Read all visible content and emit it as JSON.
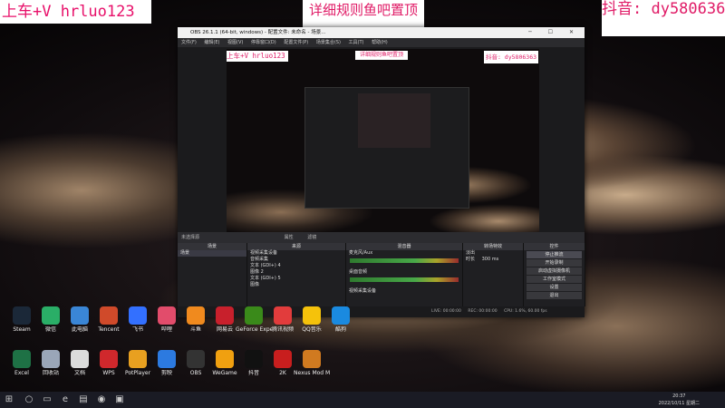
{
  "overlays": {
    "left": "上车+V hrluo123",
    "middle": "详细规则鱼吧置顶",
    "right": "抖音: dy5806363"
  },
  "obs": {
    "title": "OBS 26.1.1 (64-bit, windows) - 配置文件: 未命名 - 场景...",
    "menu": [
      "文件(F)",
      "编辑(E)",
      "视图(V)",
      "停靠窗口(D)",
      "配置文件(P)",
      "场景集合(S)",
      "工具(T)",
      "帮助(H)"
    ],
    "preview_overlays": {
      "left": "上车+V hrluo123",
      "middle": "详细规则鱼吧置顶",
      "right": "抖音: dy5806363"
    },
    "ctrl_label": "未选择源",
    "ctrl_props": "属性",
    "ctrl_filter": "滤镜",
    "docks": {
      "scenes": {
        "header": "场景",
        "items": [
          "场景"
        ]
      },
      "sources": {
        "header": "来源",
        "items": [
          "视频采集设备",
          "音频采集",
          "文本 (GDI+) 4",
          "图像 2",
          "文本 (GDI+) 5",
          "图像"
        ]
      },
      "mixer": {
        "header": "混音器",
        "channels": [
          "麦克风/Aux",
          "桌面音频",
          "视频采集设备"
        ]
      },
      "transitions": {
        "header": "转场特效",
        "type": "淡出",
        "duration_label": "时长",
        "duration": "300 ms"
      },
      "controls": {
        "header": "控件",
        "buttons": [
          "停止推流",
          "开始录制",
          "启动虚拟摄像机",
          "工作室模式",
          "设置",
          "退出"
        ]
      }
    },
    "status": {
      "live": "LIVE: 00:00:00",
      "rec": "REC: 00:00:00",
      "cpu": "CPU: 1.6%, 60.00 fps"
    }
  },
  "desktop_icons": [
    {
      "label": "Steam",
      "color": "#1b2838"
    },
    {
      "label": "微信",
      "color": "#2aae67"
    },
    {
      "label": "此电脑",
      "color": "#3a86d6"
    },
    {
      "label": "Tencent",
      "color": "#d04a2a"
    },
    {
      "label": "飞书",
      "color": "#3370ff"
    },
    {
      "label": "哔哩",
      "color": "#e24c6b"
    },
    {
      "label": "斗鱼",
      "color": "#f08a1e"
    },
    {
      "label": "网易云",
      "color": "#c8202c"
    },
    {
      "label": "GeForce Experience",
      "color": "#3a8a1a"
    },
    {
      "label": "腾讯视频",
      "color": "#e23c3c"
    },
    {
      "label": "QQ音乐",
      "color": "#f5c20b"
    },
    {
      "label": "酷狗",
      "color": "#1a8ae0"
    },
    {
      "label": "Excel",
      "color": "#1e7145"
    },
    {
      "label": "回收站",
      "color": "#9aa6b8"
    },
    {
      "label": "文档",
      "color": "#dcdcdc"
    },
    {
      "label": "WPS",
      "color": "#d0282c"
    },
    {
      "label": "PotPlayer",
      "color": "#e8a020"
    },
    {
      "label": "剪映",
      "color": "#2c7ae0"
    },
    {
      "label": "OBS",
      "color": "#333333"
    },
    {
      "label": "WeGame",
      "color": "#f0a010"
    },
    {
      "label": "抖音",
      "color": "#111111"
    },
    {
      "label": "2K",
      "color": "#c81e1e"
    },
    {
      "label": "Nexus Mod Manager",
      "color": "#d07a20"
    }
  ],
  "taskbar": {
    "time": "20:37",
    "date": "2022/10/11 星期二"
  }
}
